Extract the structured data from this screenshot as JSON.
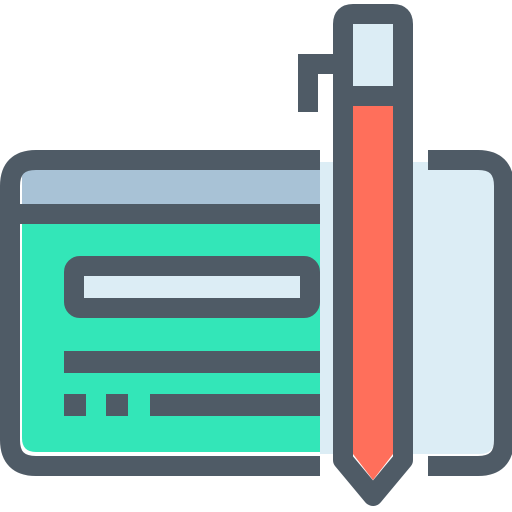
{
  "icon": {
    "name": "cheque-with-pen-icon",
    "colors": {
      "outline": "#4f5b66",
      "page_green": "#33e6b8",
      "page_header": "#a8c2d6",
      "light_blue": "#dcedf5",
      "pen_body": "#ff6f5b",
      "background": "#ffffff"
    }
  }
}
